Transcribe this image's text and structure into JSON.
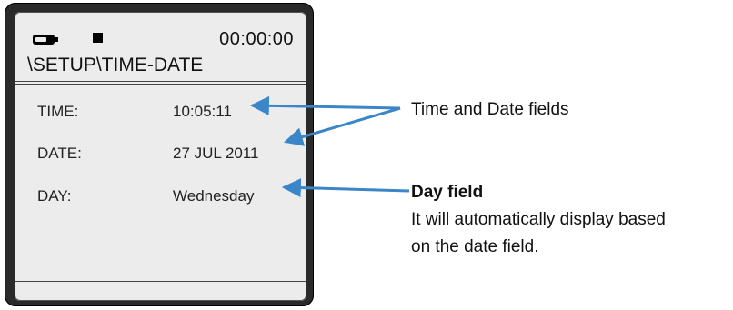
{
  "device": {
    "status": {
      "clock": "00:00:00",
      "battery_icon": "battery-icon",
      "record_icon": "record-icon"
    },
    "path_title": "\\SETUP\\TIME-DATE",
    "fields": [
      {
        "label": "TIME:",
        "value": "10:05:11"
      },
      {
        "label": "DATE:",
        "value": "27 JUL 2011"
      },
      {
        "label": "DAY:",
        "value": "Wednesday"
      }
    ]
  },
  "annotations": {
    "time_date": "Time and Date fields",
    "day_heading": "Day field",
    "day_line1": "It will automatically display based",
    "day_line2": "on the date field."
  },
  "colors": {
    "arrow": "#3a86c8",
    "screen_bg": "#ececec",
    "bezel": "#2a2a2a"
  }
}
